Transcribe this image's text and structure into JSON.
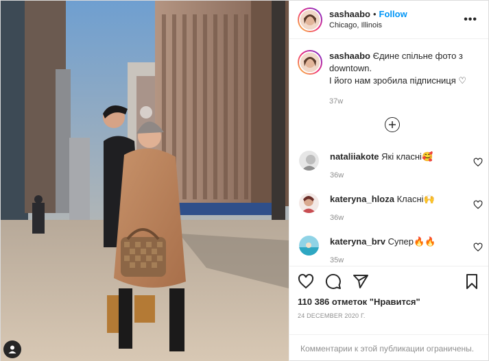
{
  "post": {
    "username": "sashaabo",
    "dot": "•",
    "follow_label": "Follow",
    "location": "Chicago, Illinois",
    "more_icon": "more-horizontal-icon",
    "more_label": "•••"
  },
  "caption": {
    "username": "sashaabo",
    "line1": "Єдине спільне фото з downtown.",
    "line2": "І його нам зробила підписниця ♡",
    "time": "37w"
  },
  "load_more_icon": "plus-circle-icon",
  "comments": [
    {
      "username": "nataliiakote",
      "text": "Які класні🥰",
      "time": "36w"
    },
    {
      "username": "kateryna_hloza",
      "text": "Класні🙌",
      "time": "36w"
    },
    {
      "username": "kateryna_brv",
      "text": "Супер🔥🔥",
      "time": "35w"
    }
  ],
  "actions": {
    "like_icon": "heart-icon",
    "comment_icon": "comment-icon",
    "share_icon": "share-icon",
    "save_icon": "bookmark-icon"
  },
  "likes_text": "110 386 отметок \"Нравится\"",
  "date_text": "24 DECEMBER 2020 г.",
  "comments_disabled_text": "Комментарии к этой публикации ограничены.",
  "colors": {
    "accent": "#0095f6",
    "text": "#262626",
    "muted": "#8e8e8e",
    "border": "#efefef"
  }
}
